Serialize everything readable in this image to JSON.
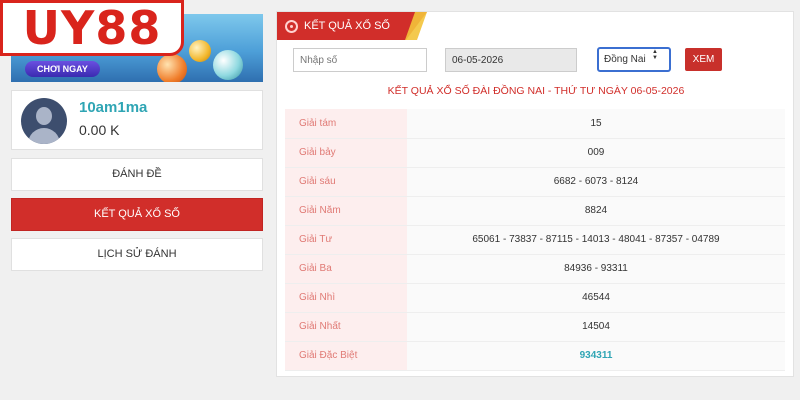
{
  "logo": {
    "text": "UY88"
  },
  "banner": {
    "play_label": "CHƠI NGAY"
  },
  "user": {
    "username": "10am1ma",
    "balance": "0.00 K"
  },
  "sidebar": {
    "items": [
      {
        "label": "ĐÁNH ĐỀ",
        "active": false
      },
      {
        "label": "KẾT QUẢ XỔ SỐ",
        "active": true
      },
      {
        "label": "LỊCH SỬ ĐÁNH",
        "active": false
      }
    ]
  },
  "panel": {
    "tab_label": "KẾT QUẢ XỔ SỐ",
    "search_placeholder": "Nhập số",
    "date_value": "06-05-2026",
    "province_selected": "Đồng Nai",
    "submit_label": "XEM",
    "result_title": "KẾT QUẢ XỔ SỐ ĐÀI ĐỒNG NAI - THỨ TƯ NGÀY 06-05-2026"
  },
  "results": [
    {
      "prize": "Giải tám",
      "numbers": "15"
    },
    {
      "prize": "Giải bảy",
      "numbers": "009"
    },
    {
      "prize": "Giải sáu",
      "numbers": "6682 - 6073 - 8124"
    },
    {
      "prize": "Giải Năm",
      "numbers": "8824"
    },
    {
      "prize": "Giải Tư",
      "numbers": "65061 - 73837 - 87115 - 14013 - 48041 - 87357 - 04789"
    },
    {
      "prize": "Giải Ba",
      "numbers": "84936 - 93311"
    },
    {
      "prize": "Giải Nhì",
      "numbers": "46544"
    },
    {
      "prize": "Giải Nhất",
      "numbers": "14504"
    },
    {
      "prize": "Giải Đặc Biệt",
      "numbers": "934311"
    }
  ],
  "colors": {
    "accent": "#d12e2a",
    "teal": "#2fa5b4",
    "label_bg": "#fdeeee"
  }
}
